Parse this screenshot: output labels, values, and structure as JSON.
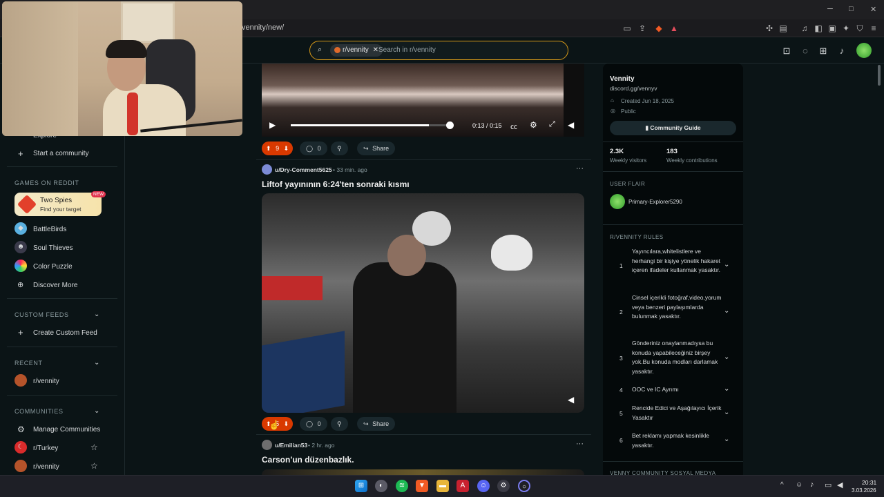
{
  "browser": {
    "url": "vennity/new/",
    "minimize": "─",
    "maximize": "□",
    "close": "✕"
  },
  "header": {
    "search_chip": "r/vennity",
    "search_placeholder": "Search in r/vennity"
  },
  "left_sidebar": {
    "explore": "Explore",
    "start_community": "Start a community",
    "games_label": "GAMES ON REDDIT",
    "featured_game": {
      "title": "Two Spies",
      "subtitle": "Find your target",
      "badge": "NEW"
    },
    "games": [
      "BattleBirds",
      "Soul Thieves",
      "Color Puzzle",
      "Discover More"
    ],
    "custom_feeds_label": "CUSTOM FEEDS",
    "create_custom_feed": "Create Custom Feed",
    "recent_label": "RECENT",
    "recent_items": [
      "r/vennity"
    ],
    "communities_label": "COMMUNITIES",
    "manage_communities": "Manage Communities",
    "communities": [
      "r/Turkey",
      "r/vennity"
    ]
  },
  "feed": {
    "post0": {
      "player_time": "0:13 / 0:15",
      "progress": 0.87,
      "votes": "9",
      "comments": "0",
      "share": "Share"
    },
    "post1": {
      "author": "u/Dry-Comment5625",
      "age": "• 33 min. ago",
      "title": "Liftof yayınının 6:24'ten sonraki kısmı",
      "votes": "5",
      "comments": "0",
      "share": "Share"
    },
    "post2": {
      "author": "u/Emilian53",
      "age": "• 2 hr. ago",
      "title": "Carson'un düzenbazlık."
    }
  },
  "right_sidebar": {
    "name": "Vennity",
    "link": "discord.gg/vennyv",
    "created": "Created Jun 18, 2025",
    "visibility": "Public",
    "guide_button": "Community Guide",
    "visitors_value": "2.3K",
    "visitors_label": "Weekly visitors",
    "contrib_value": "183",
    "contrib_label": "Weekly contributions",
    "user_flair_label": "USER FLAIR",
    "user_flair": "Primary-Explorer5290",
    "rules_label": "R/VENNITY RULES",
    "rules": [
      "Yayıncılara,whitelistlere ve herhangi bir kişiye yönelik hakaret içeren ifadeler kullanmak yasaktır.",
      "Cinsel içerikli fotoğraf,video,yorum veya benzeri paylaşımlarda bulunmak yasaktır.",
      "Gönderiniz onaylanmadıysa bu konuda yapabileceğiniz birşey yok.Bu konuda modları darlamak yasaktır.",
      "OOC ve IC Ayrımı",
      "Rencide Edici ve Aşağılayıcı İçerik Yasaktır",
      "Bet reklamı yapmak kesinlikle yasaktır."
    ],
    "footer_label": "VENNY COMMUNITY SOSYAL MEDYA"
  },
  "taskbar": {
    "time": "20:31",
    "date": "3.03.2026"
  },
  "colors": {
    "accent": "#d93900",
    "search_border": "#d89a18",
    "background": "#0b1416"
  }
}
